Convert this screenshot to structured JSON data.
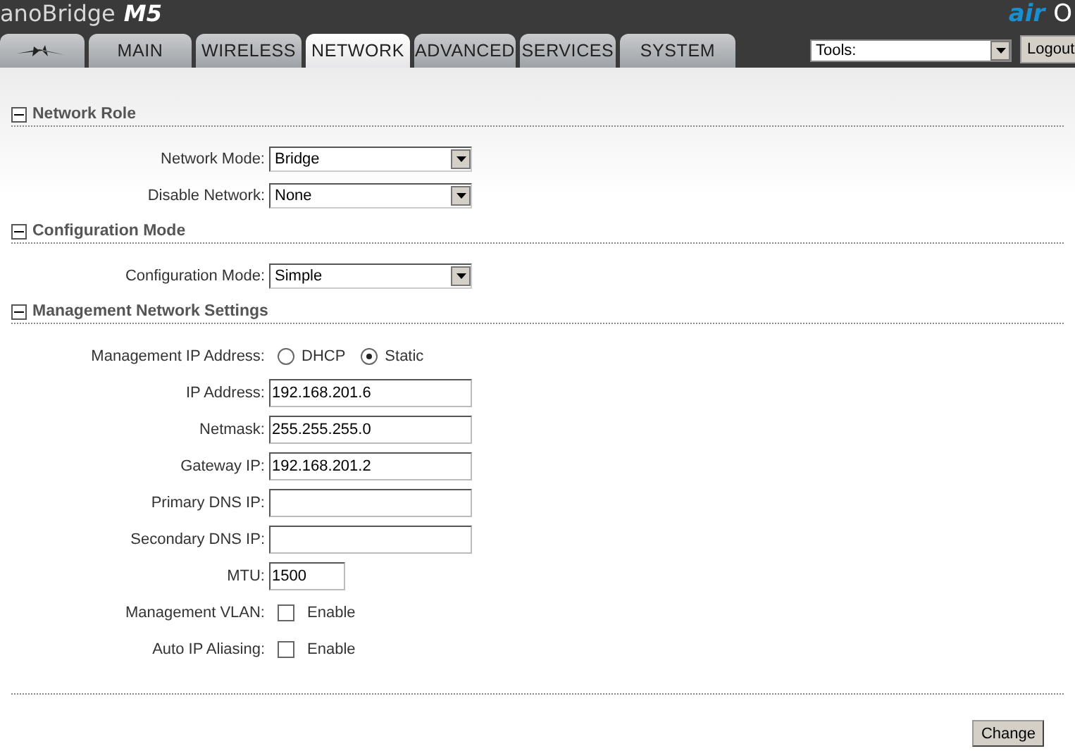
{
  "header": {
    "product": "anoBridge",
    "model": "M5",
    "brand_air": "air",
    "brand_os": "O"
  },
  "tabs": [
    {
      "kind": "logo",
      "selected": false
    },
    {
      "label": "MAIN",
      "selected": false
    },
    {
      "label": "WIRELESS",
      "selected": false
    },
    {
      "label": "NETWORK",
      "selected": true
    },
    {
      "label": "ADVANCED",
      "selected": false
    },
    {
      "label": "SERVICES",
      "selected": false
    },
    {
      "label": "SYSTEM",
      "selected": false
    }
  ],
  "tools": {
    "value": "Tools:"
  },
  "logout": "Logout",
  "sections": [
    {
      "title": "Network Role",
      "expanded": true,
      "fields": [
        {
          "kind": "select",
          "label": "Network Mode:",
          "value": "Bridge"
        },
        {
          "kind": "select",
          "label": "Disable Network:",
          "value": "None"
        }
      ]
    },
    {
      "title": "Configuration Mode",
      "expanded": true,
      "fields": [
        {
          "kind": "select",
          "label": "Configuration Mode:",
          "value": "Simple"
        }
      ]
    },
    {
      "title": "Management Network Settings",
      "expanded": true,
      "fields": [
        {
          "kind": "radio",
          "label": "Management IP Address:",
          "options": [
            {
              "label": "DHCP",
              "selected": false
            },
            {
              "label": "Static",
              "selected": true
            }
          ]
        },
        {
          "kind": "text",
          "label": "IP Address:",
          "value": "192.168.201.6"
        },
        {
          "kind": "text",
          "label": "Netmask:",
          "value": "255.255.255.0"
        },
        {
          "kind": "text",
          "label": "Gateway IP:",
          "value": "192.168.201.2"
        },
        {
          "kind": "text",
          "label": "Primary DNS IP:"
        },
        {
          "kind": "text",
          "label": "Secondary DNS IP:"
        },
        {
          "kind": "short",
          "label": "MTU:",
          "value": "1500"
        },
        {
          "kind": "checkbox",
          "label": "Management VLAN:",
          "option": "Enable",
          "checked": false
        },
        {
          "kind": "checkbox",
          "label": "Auto IP Aliasing:",
          "option": "Enable",
          "checked": false
        }
      ]
    }
  ],
  "submit": "Change"
}
